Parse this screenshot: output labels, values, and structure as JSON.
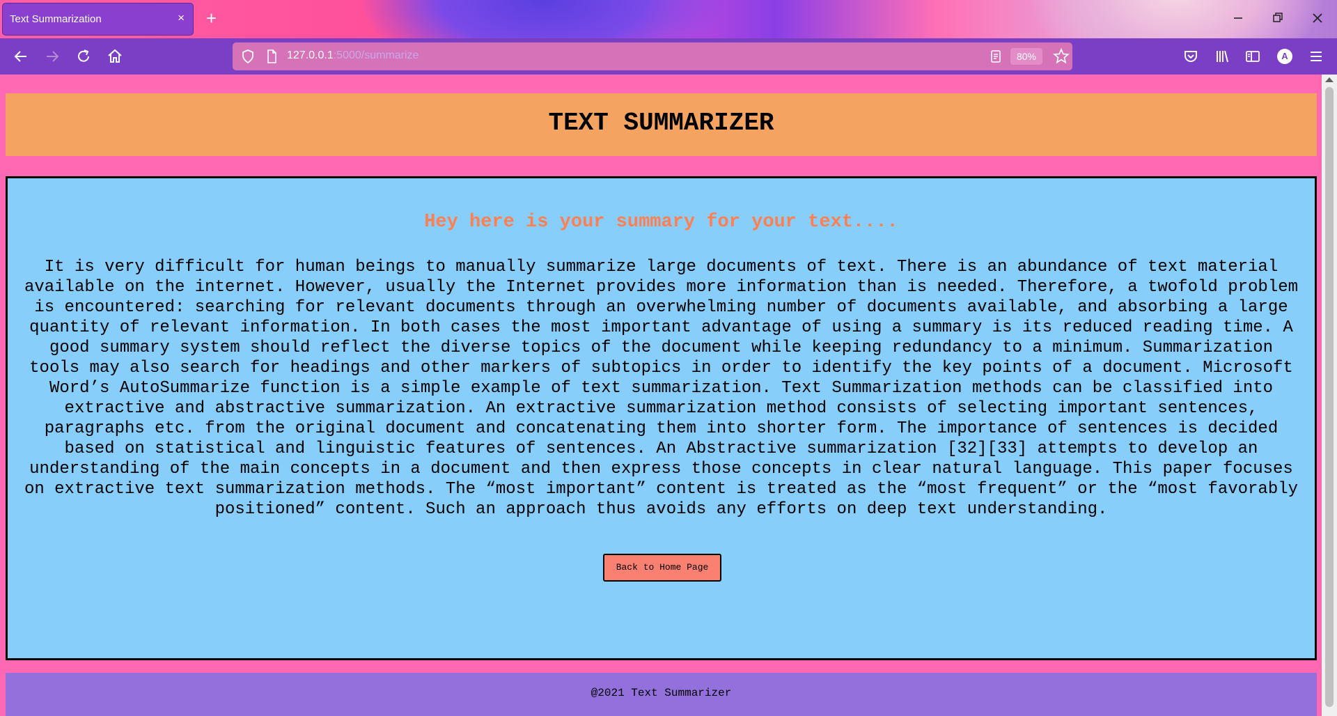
{
  "browser": {
    "tab": {
      "title": "Text Summarization",
      "close_glyph": "×"
    },
    "new_tab_glyph": "+",
    "url": {
      "host": "127.0.0.1",
      "path": ":5000/summarize"
    },
    "zoom": "80%",
    "icons": {
      "back": "back-arrow-icon",
      "forward": "forward-arrow-icon",
      "reload": "reload-icon",
      "home": "home-icon",
      "shield": "shield-icon",
      "page": "page-icon",
      "reader": "reader-view-icon",
      "bookmark": "star-icon",
      "pocket": "pocket-icon",
      "library": "library-icon",
      "sidebar": "sidebar-icon",
      "account": "account-icon",
      "menu": "hamburger-menu-icon"
    },
    "account_initial": "A"
  },
  "page": {
    "header_title": "TEXT SUMMARIZER",
    "summary_heading": "Hey here is your summary for your text....",
    "summary_text": "It is very difficult for human beings to manually summarize large documents of text. There is an abundance of text material available on the internet. However, usually the Internet provides more information than is needed. Therefore, a twofold problem is encountered: searching for relevant documents through an overwhelming number of documents available, and absorbing a large quantity of relevant information. In both cases the most important advantage of using a summary is its reduced reading time. A good summary system should reflect the diverse topics of the document while keeping redundancy to a minimum. Summarization tools may also search for headings and other markers of subtopics in order to identify the key points of a document. Microsoft Word’s AutoSummarize function is a simple example of text summarization. Text Summarization methods can be classified into extractive and abstractive summarization. An extractive summarization method consists of selecting important sentences, paragraphs etc. from the original document and concatenating them into shorter form. The importance of sentences is decided based on statistical and linguistic features of sentences. An Abstractive summarization [32][33] attempts to develop an understanding of the main concepts in a document and then express those concepts in clear natural language. This paper focuses on extractive text summarization methods. The “most important” content is treated as the “most frequent” or the “most favorably positioned” content. Such an approach thus avoids any efforts on deep text understanding.",
    "back_button_label": "Back to Home Page",
    "footer_text": "@2021 Text Summarizer"
  },
  "colors": {
    "page_background": "#ff69b4",
    "header_background": "#f4a460",
    "content_background": "#87cefa",
    "heading_color": "#ff7f50",
    "button_background": "#fa8072",
    "footer_background": "#9370db"
  }
}
